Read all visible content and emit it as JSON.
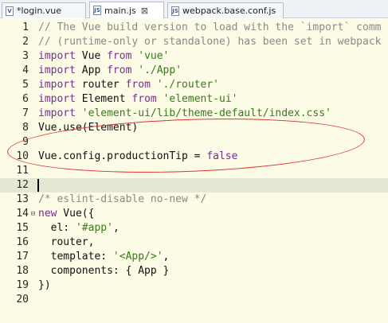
{
  "tabs": [
    {
      "label": "*login.vue",
      "active": false
    },
    {
      "label": "main.js",
      "active": true
    },
    {
      "label": "webpack.base.conf.js",
      "active": false
    }
  ],
  "tab_close_glyph": "⊠",
  "lines": {
    "l1": {
      "num": "1",
      "t": [
        {
          "c": "cm",
          "s": "// The Vue build version to load with the `import` comm"
        }
      ]
    },
    "l2": {
      "num": "2",
      "t": [
        {
          "c": "cm",
          "s": "// (runtime-only or standalone) has been set in webpack"
        }
      ]
    },
    "l3": {
      "num": "3",
      "t": [
        {
          "c": "kw",
          "s": "import"
        },
        {
          "c": "plain",
          "s": " Vue "
        },
        {
          "c": "kw",
          "s": "from"
        },
        {
          "c": "plain",
          "s": " "
        },
        {
          "c": "str",
          "s": "'vue'"
        }
      ]
    },
    "l4": {
      "num": "4",
      "t": [
        {
          "c": "kw",
          "s": "import"
        },
        {
          "c": "plain",
          "s": " App "
        },
        {
          "c": "kw",
          "s": "from"
        },
        {
          "c": "plain",
          "s": " "
        },
        {
          "c": "str",
          "s": "'./App'"
        }
      ]
    },
    "l5": {
      "num": "5",
      "t": [
        {
          "c": "kw",
          "s": "import"
        },
        {
          "c": "plain",
          "s": " router "
        },
        {
          "c": "kw",
          "s": "from"
        },
        {
          "c": "plain",
          "s": " "
        },
        {
          "c": "str",
          "s": "'./router'"
        }
      ]
    },
    "l6": {
      "num": "6",
      "t": [
        {
          "c": "kw",
          "s": "import"
        },
        {
          "c": "plain",
          "s": " Element "
        },
        {
          "c": "kw",
          "s": "from"
        },
        {
          "c": "plain",
          "s": " "
        },
        {
          "c": "str",
          "s": "'element-ui'"
        }
      ]
    },
    "l7": {
      "num": "7",
      "t": [
        {
          "c": "kw",
          "s": "import"
        },
        {
          "c": "plain",
          "s": " "
        },
        {
          "c": "str",
          "s": "'element-ui/lib/theme-default/index.css'"
        }
      ]
    },
    "l8": {
      "num": "8",
      "t": [
        {
          "c": "plain",
          "s": "Vue.use(Element)"
        }
      ]
    },
    "l9": {
      "num": "9",
      "t": []
    },
    "l10": {
      "num": "10",
      "t": [
        {
          "c": "plain",
          "s": "Vue.config.productionTip = "
        },
        {
          "c": "kw",
          "s": "false"
        }
      ]
    },
    "l11": {
      "num": "11",
      "t": []
    },
    "l12": {
      "num": "12",
      "t": []
    },
    "l13": {
      "num": "13",
      "t": [
        {
          "c": "cm",
          "s": "/* eslint-disable no-new */"
        }
      ]
    },
    "l14": {
      "num": "14",
      "t": [
        {
          "c": "kw",
          "s": "new"
        },
        {
          "c": "plain",
          "s": " Vue({"
        }
      ]
    },
    "l15": {
      "num": "15",
      "t": [
        {
          "c": "plain",
          "s": "  el: "
        },
        {
          "c": "str",
          "s": "'#app'"
        },
        {
          "c": "plain",
          "s": ","
        }
      ]
    },
    "l16": {
      "num": "16",
      "t": [
        {
          "c": "plain",
          "s": "  router,"
        }
      ]
    },
    "l17": {
      "num": "17",
      "t": [
        {
          "c": "plain",
          "s": "  template: "
        },
        {
          "c": "str",
          "s": "'<App/>'"
        },
        {
          "c": "plain",
          "s": ","
        }
      ]
    },
    "l18": {
      "num": "18",
      "t": [
        {
          "c": "plain",
          "s": "  components: { App }"
        }
      ]
    },
    "l19": {
      "num": "19",
      "t": [
        {
          "c": "plain",
          "s": "})"
        }
      ]
    },
    "l20": {
      "num": "20",
      "t": []
    }
  },
  "fold_glyph": "⊟",
  "colors": {
    "editor_bg": "#fbfbe6",
    "keyword": "#7a2a9a",
    "string": "#3a7a1a",
    "comment": "#8a8a8a",
    "annotation": "#dd3333"
  }
}
